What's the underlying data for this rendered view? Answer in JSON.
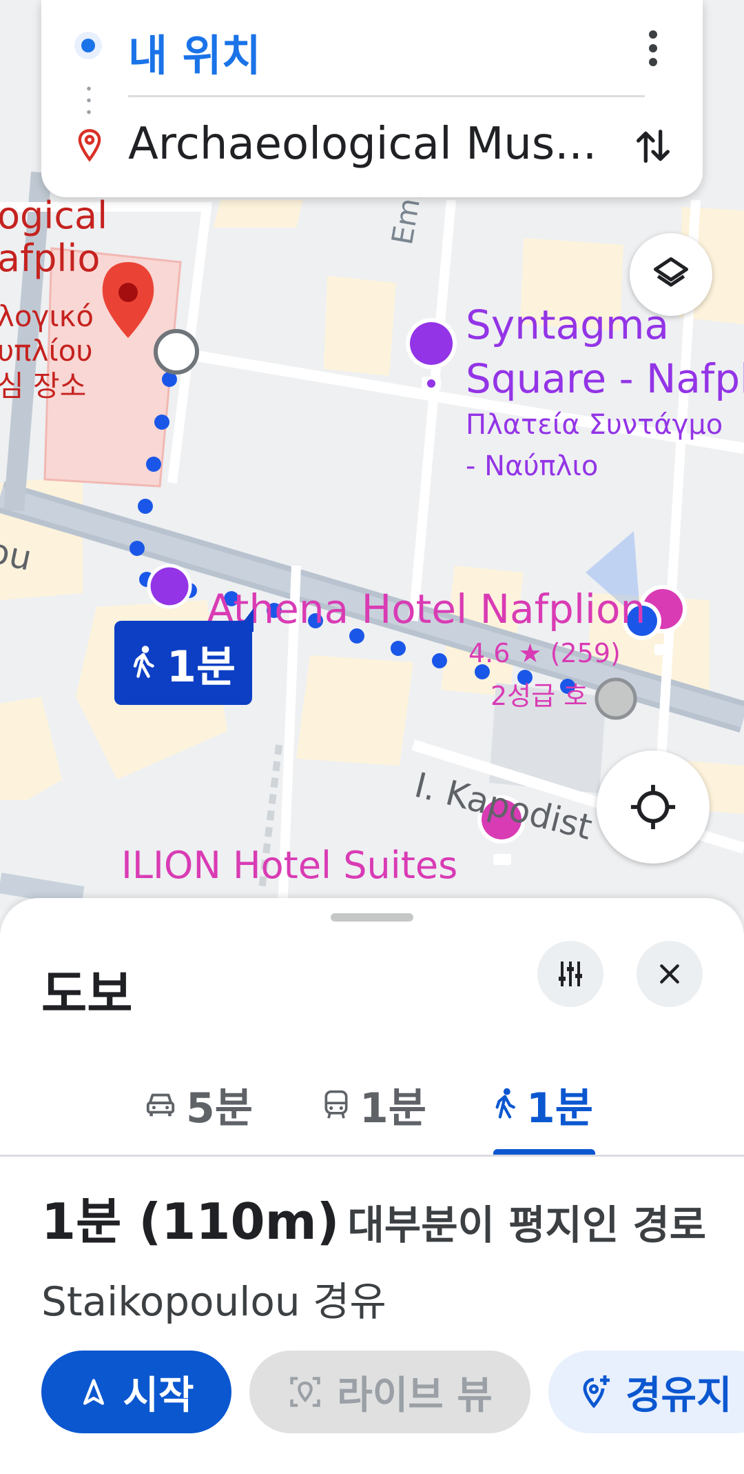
{
  "search": {
    "origin": "내 위치",
    "destination": "Archaeological Mus..."
  },
  "map": {
    "labels": {
      "museum_line1": "ogical",
      "museum_line2": "afplio",
      "museum_greek1": "λογικό",
      "museum_greek2": "υπλίου",
      "museum_kor": "심 장소",
      "syntagma_line1": "Syntagma",
      "syntagma_line2": "Square - Nafpl",
      "syntagma_greek1": "Πλατεία Συντάγμο",
      "syntagma_greek2": "- Ναύπλιο",
      "athena": "Athena Hotel Nafplion",
      "athena_rating": "4.6 ★ (259)",
      "athena_sub": "2성급 호",
      "ilion": "ILION Hotel Suites",
      "street_emm": "Emm",
      "street_kap": "I. Kapodist",
      "street_ou": "ou"
    },
    "route_badge": "1분",
    "colors": {
      "route": "#1a57e8",
      "destination_pin": "#ea4335",
      "poi_hotel": "#d93bb4",
      "poi_landmark": "#9334e6"
    }
  },
  "sheet": {
    "title": "도보",
    "tabs": [
      {
        "mode": "car",
        "label": "5분",
        "icon": "car-icon"
      },
      {
        "mode": "transit",
        "label": "1분",
        "icon": "bus-icon"
      },
      {
        "mode": "walk",
        "label": "1분",
        "icon": "walk-icon",
        "active": true
      }
    ],
    "summary": {
      "time_distance": "1분 (110m)",
      "description": "대부분이 평지인 경로",
      "via": "Staikopoulou 경유"
    },
    "actions": {
      "start": "시작",
      "live_view": "라이브 뷰",
      "waypoint": "경유지"
    }
  }
}
